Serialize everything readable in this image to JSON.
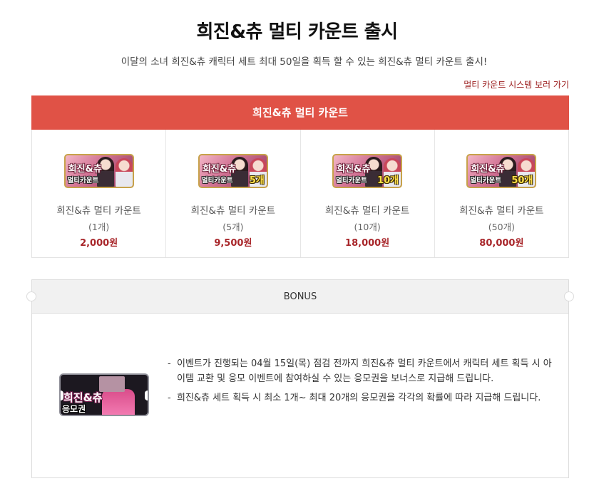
{
  "page": {
    "title": "희진&츄 멀티 카운트 출시",
    "subtitle": "이달의 소녀 희진&츄 캐릭터 세트 최대 50일을 획득 할 수 있는 희진&츄 멀티 카운트 출시!",
    "system_link": "멀티 카운트 시스템 보러 가기"
  },
  "products": {
    "header": "희진&츄 멀티 카운트",
    "items": [
      {
        "thumb_title": "희진&츄",
        "thumb_sub": "멀티카운트",
        "thumb_count": "",
        "name": "희진&츄 멀티 카운트",
        "qty": "(1개)",
        "price": "2,000원"
      },
      {
        "thumb_title": "희진&츄",
        "thumb_sub": "멀티카운트",
        "thumb_count": "5개",
        "name": "희진&츄 멀티 카운트",
        "qty": "(5개)",
        "price": "9,500원"
      },
      {
        "thumb_title": "희진&츄",
        "thumb_sub": "멀티카운트",
        "thumb_count": "10개",
        "name": "희진&츄 멀티 카운트",
        "qty": "(10개)",
        "price": "18,000원"
      },
      {
        "thumb_title": "희진&츄",
        "thumb_sub": "멀티카운트",
        "thumb_count": "50개",
        "name": "희진&츄 멀티 카운트",
        "qty": "(50개)",
        "price": "80,000원"
      }
    ]
  },
  "bonus": {
    "header": "BONUS",
    "ticket_title": "희진&츄",
    "ticket_sub": "응모권",
    "items": [
      "이벤트가 진행되는 04월 15일(목) 점검 전까지 희진&츄 멀티 카운트에서 캐릭터 세트 획득 시 아이템 교환 및 응모 이벤트에 참여하실 수 있는 응모권을 보너스로 지급해 드립니다.",
      "희진&츄 세트 획득 시 최소 1개~ 최대 20개의 응모권을 각각의 확률에 따라 지급해 드립니다."
    ]
  },
  "colors": {
    "header_red": "#e05246",
    "price_red": "#a8262a",
    "link_red": "#9b1c1c"
  }
}
